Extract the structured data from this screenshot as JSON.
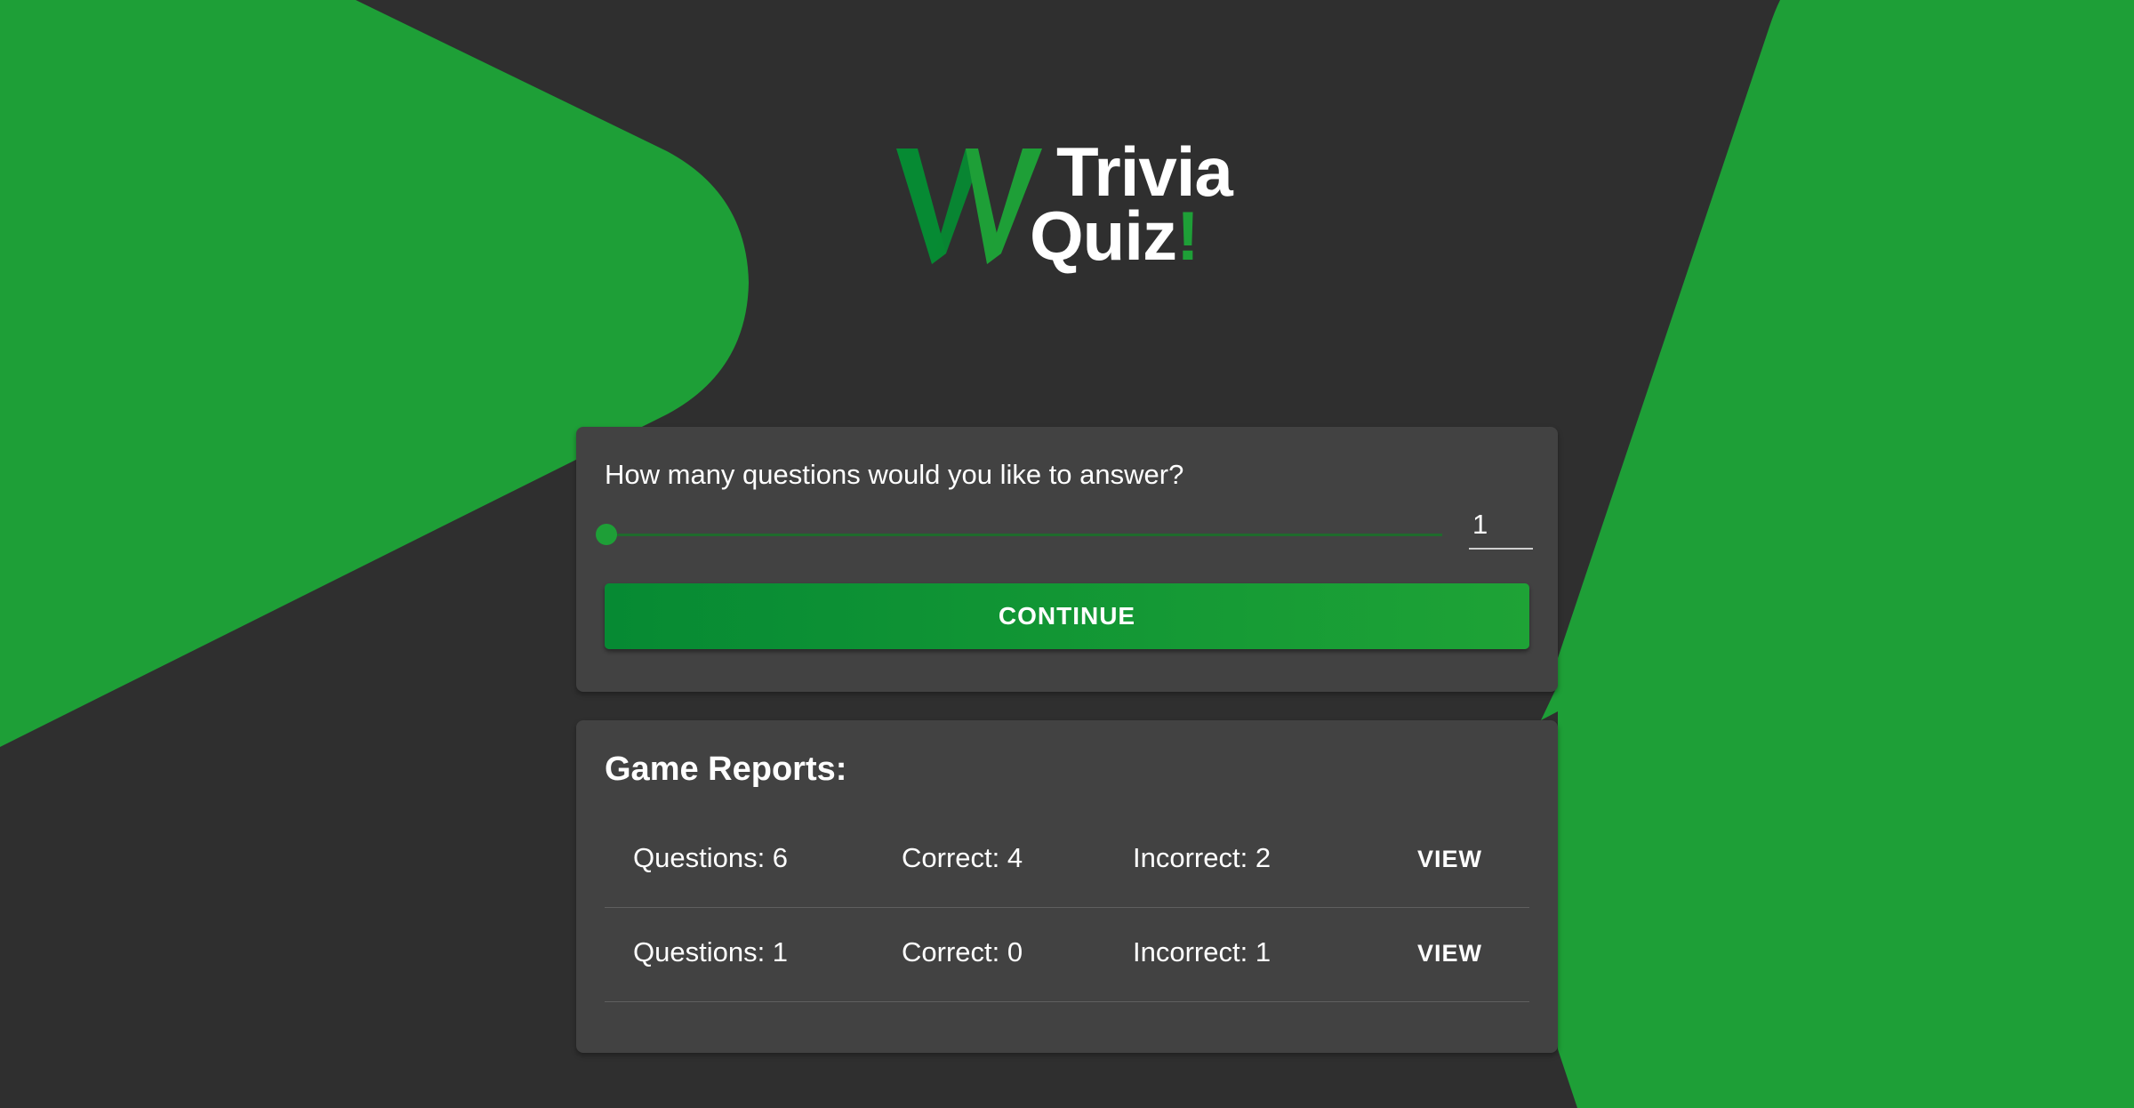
{
  "theme": {
    "background": "#2f2f2f",
    "accent": "#1e9f37",
    "accent_dark": "#068a33",
    "card": "#424242"
  },
  "logo": {
    "mark": "W",
    "line1": "Trivia",
    "line2": "Quiz",
    "exclaim": "!"
  },
  "setup": {
    "question": "How many questions would you like to answer?",
    "slider_value": 1,
    "count_value": "1",
    "continue_label": "CONTINUE"
  },
  "reports": {
    "title": "Game Reports:",
    "rows": [
      {
        "questions": "Questions: 6",
        "correct": "Correct: 4",
        "incorrect": "Incorrect: 2",
        "view_label": "VIEW"
      },
      {
        "questions": "Questions: 1",
        "correct": "Correct: 0",
        "incorrect": "Incorrect: 1",
        "view_label": "VIEW"
      }
    ]
  }
}
